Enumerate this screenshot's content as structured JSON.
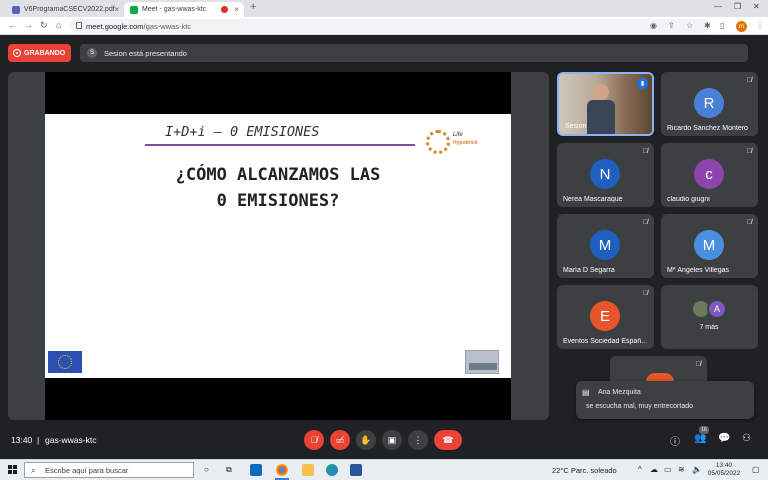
{
  "browser": {
    "tabs": [
      {
        "label": "V6ProgramaCSECV2022.pdf",
        "close": "×"
      },
      {
        "label": "Meet - gas-wwas-ktc",
        "close": "×"
      }
    ],
    "new_tab": "+",
    "url_host": "meet.google.com",
    "url_path": "/gas-wwas-ktc",
    "profile_initial": "m"
  },
  "meet": {
    "recording_label": "GRABANDO",
    "presenter_initial": "S",
    "presenting_text": "Sesion está presentando",
    "slide": {
      "header": "I+D+i – 0 EMISIONES",
      "title_line1": "¿CÓMO ALCANZAMOS LAS",
      "title_line2": "0 EMISIONES?",
      "logo_text": "Life",
      "logo_sub": "Hypobrick"
    },
    "participants": [
      {
        "name": "Sesion",
        "initial": "",
        "color": ""
      },
      {
        "name": "Ricardo Sánchez Montero",
        "initial": "R",
        "color": "#4a7fd6"
      },
      {
        "name": "Nerea Mascaraque",
        "initial": "N",
        "color": "#1f5fbf"
      },
      {
        "name": "claudio giugni",
        "initial": "c",
        "color": "#8e44ad"
      },
      {
        "name": "María D Segarra",
        "initial": "M",
        "color": "#1f5fbf"
      },
      {
        "name": "Mª Ángeles Villegas",
        "initial": "M",
        "color": "#4a8fe0"
      },
      {
        "name": "Eventos Sociedad Españ...",
        "initial": "E",
        "color": "#e8552b"
      }
    ],
    "more_tile": {
      "label": "7 más",
      "initial": "A"
    },
    "chat_toast": {
      "sender": "Ana Mezquita",
      "message": "se escucha mal, muy entrecortado"
    },
    "meeting_time": "13:40",
    "meeting_separator": "|",
    "meeting_code": "gas-wwas-ktc",
    "people_count": "16"
  },
  "taskbar": {
    "search_placeholder": "Escribe aquí para buscar",
    "weather": "22°C  Parc. soleado",
    "time": "13:40",
    "date": "05/05/2022"
  }
}
